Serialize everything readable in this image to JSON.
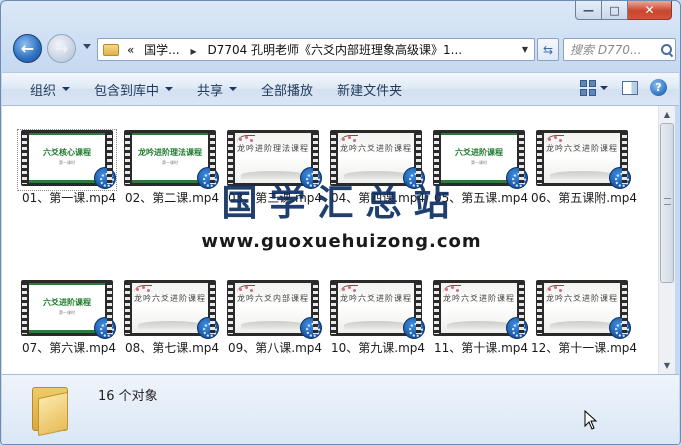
{
  "window": {
    "caption": {
      "minimize": "—",
      "maximize": "□",
      "close": "✕"
    }
  },
  "nav": {
    "back_glyph": "←",
    "forward_glyph": "→",
    "address": {
      "prefix": "«",
      "segments": [
        "国学...",
        "D7704 孔明老师《六爻内部班理象高级课》1..."
      ],
      "separator": "▶"
    },
    "refresh_glyph": "⇆",
    "search": {
      "placeholder": "搜索 D770..."
    }
  },
  "toolbar": {
    "organize": "组织",
    "include_in_library": "包含到库中",
    "share": "共享",
    "play_all": "全部播放",
    "new_folder": "新建文件夹",
    "help": "?"
  },
  "files": [
    {
      "label": "01、第一课.mp4",
      "thumb": "六爻核心课程",
      "style": "green",
      "selected": true
    },
    {
      "label": "02、第二课.mp4",
      "thumb": "龙吟进阶理法课程",
      "style": "green"
    },
    {
      "label": "03、第三课.mp4",
      "thumb": "龙吟进阶理法课程",
      "style": "ink"
    },
    {
      "label": "04、第四课.mp4",
      "thumb": "龙吟六爻进阶课程",
      "style": "ink"
    },
    {
      "label": "05、第五课.mp4",
      "thumb": "六爻进阶课程",
      "style": "green"
    },
    {
      "label": "06、第五课附.mp4",
      "thumb": "龙吟六爻进阶课程",
      "style": "ink"
    },
    {
      "label": "07、第六课.mp4",
      "thumb": "六爻进阶课程",
      "style": "green"
    },
    {
      "label": "08、第七课.mp4",
      "thumb": "龙吟六爻进阶课程",
      "style": "ink"
    },
    {
      "label": "09、第八课.mp4",
      "thumb": "龙吟六爻内部课程",
      "style": "ink"
    },
    {
      "label": "10、第九课.mp4",
      "thumb": "龙吟六爻进阶课程",
      "style": "ink"
    },
    {
      "label": "11、第十课.mp4",
      "thumb": "龙吟六爻进阶课程",
      "style": "ink"
    },
    {
      "label": "12、第十一课.mp4",
      "thumb": "龙吟六爻进阶课程",
      "style": "ink"
    }
  ],
  "thumb_subtitle": "第一课时",
  "watermark": {
    "title": "国学汇总站",
    "url": "www.guoxuehuizong.com"
  },
  "details": {
    "count": "16 个对象"
  },
  "colors": {
    "accent": "#1c5aa9",
    "course_green": "#1e7a2e",
    "watermark": "#0e2f62"
  }
}
